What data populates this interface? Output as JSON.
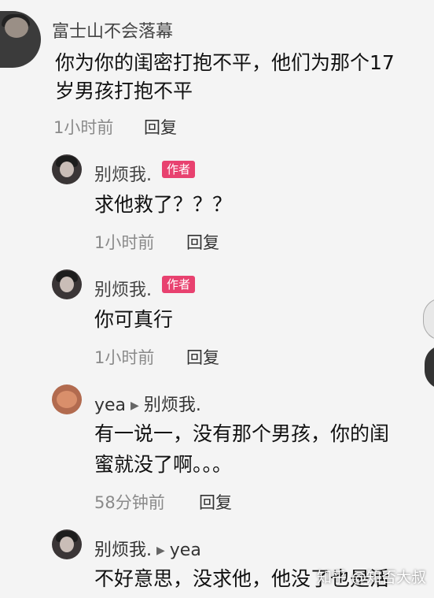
{
  "comment": {
    "author": "富士山不会落幕",
    "text_line1": "你为你的闺密打抱不平，他们为那个17",
    "text_line2": "岁男孩打抱不平",
    "time": "1小时前",
    "reply_label": "回复"
  },
  "replies": [
    {
      "author": "别烦我.",
      "badge": "作者",
      "text": "求他救了？？？",
      "time": "1小时前",
      "reply_label": "回复"
    },
    {
      "author": "别烦我.",
      "badge": "作者",
      "text": "你可真行",
      "time": "1小时前",
      "reply_label": "回复"
    },
    {
      "author": "yea",
      "reply_to": "别烦我.",
      "text_line1": "有一说一，没有那个男孩，你的闺",
      "text_line2": "蜜就没了啊。。。",
      "time": "58分钟前",
      "reply_label": "回复"
    },
    {
      "author": "别烦我.",
      "reply_to": "yea",
      "text_line1": "不好意思，没求他，他没了也是活"
    }
  ],
  "watermark": "知乎 @知否大叔",
  "colors": {
    "badge": "#e8416f",
    "background": "#f4f4f4"
  }
}
